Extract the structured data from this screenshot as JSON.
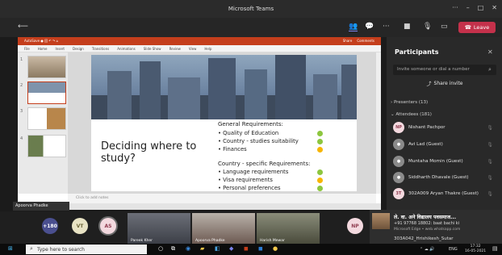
{
  "window": {
    "title": "Microsoft Teams"
  },
  "toolbar": {
    "leave_label": "Leave"
  },
  "ppt": {
    "title_left": "AutoSave ● 回 ↶ ↷ ⌂",
    "tabs": [
      "File",
      "Home",
      "Insert",
      "Design",
      "Transitions",
      "Animations",
      "Slide Show",
      "Review",
      "View",
      "Help"
    ],
    "share": "Share",
    "comments": "Comments",
    "notes_placeholder": "Click to add notes",
    "slide_numbers": [
      "1",
      "2",
      "3",
      "4"
    ]
  },
  "slide": {
    "heading": "Deciding where to study?",
    "general_heading": "General Requirements:",
    "general_items": [
      {
        "text": "Quality of Education",
        "color": "#8dc63f"
      },
      {
        "text": "Country - studies suitability",
        "color": "#8dc63f"
      },
      {
        "text": "Finances",
        "color": "#f7b500"
      }
    ],
    "country_heading": "Country - specific Requirements:",
    "country_items": [
      {
        "text": "Language requirements",
        "color": "#8dc63f"
      },
      {
        "text": "Visa requirements",
        "color": "#f7b500"
      },
      {
        "text": "Personal preferences",
        "color": "#8dc63f"
      }
    ]
  },
  "presenter": {
    "name": "Apoorva Phadke"
  },
  "strip": {
    "overflow": "+180",
    "avatars": [
      {
        "initials": "VT",
        "bg": "#e8e3c4",
        "fg": "#6b6438"
      },
      {
        "initials": "AS",
        "bg": "#f3d9df",
        "fg": "#8e3a4e"
      },
      {
        "initials": "NP",
        "bg": "#f3d9df",
        "fg": "#8e3a4e"
      }
    ],
    "videos": [
      {
        "label": "Pareek Kher"
      },
      {
        "label": "Apoorva Phadke"
      },
      {
        "label": "Harish Mewar"
      }
    ]
  },
  "participants": {
    "title": "Participants",
    "search_placeholder": "Invite someone or dial a number",
    "share_invite": "Share invite",
    "presenters": "Presenters (13)",
    "attendees": "Attendees (181)",
    "list": [
      {
        "name": "Nishant Pachpor",
        "initials": "NP",
        "bg": "#f3d9df",
        "fg": "#8e3a4e"
      },
      {
        "name": "Avi Lad (Guest)",
        "initials": "",
        "bg": "#8a8a8a",
        "fg": "#fff"
      },
      {
        "name": "Muntaha Momin (Guest)",
        "initials": "",
        "bg": "#8a8a8a",
        "fg": "#fff"
      },
      {
        "name": "Siddharth Dhavale (Guest)",
        "initials": "",
        "bg": "#8a8a8a",
        "fg": "#fff"
      },
      {
        "name": "302A009 Aryan Thakre (Guest)",
        "initials": "3T",
        "bg": "#f3d9df",
        "fg": "#8e3a4e"
      }
    ]
  },
  "notification": {
    "title": "ले. वा. अने विद्यालय पवसमाज...",
    "line2": "+91 97768 18802: baat bachi ki",
    "line3": "Microsoft Edge • web.whatsapp.com",
    "line4": "303A042_Hrishikesh_Sutar"
  },
  "taskbar": {
    "search_placeholder": "Type here to search",
    "lang": "ENG",
    "time": "17:32",
    "date": "16-05-2021"
  }
}
